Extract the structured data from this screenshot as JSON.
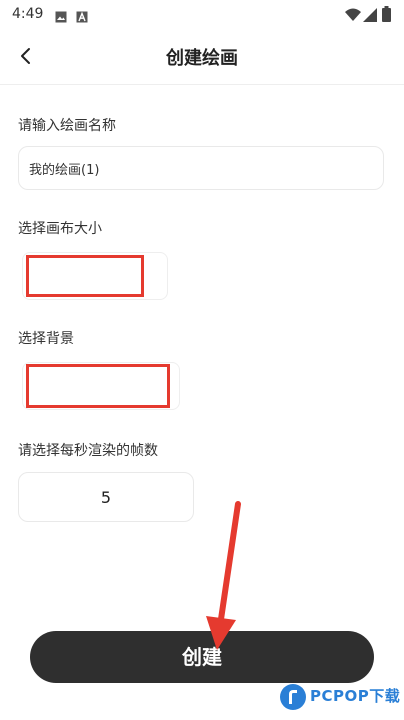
{
  "status_bar": {
    "time": "4:49",
    "icons": [
      "gallery-icon",
      "a-letter-icon",
      "wifi-icon",
      "signal-icon",
      "battery-icon"
    ]
  },
  "header": {
    "title": "创建绘画",
    "back_icon": "chevron-left-icon"
  },
  "form": {
    "name_label": "请输入绘画名称",
    "name_value": "我的绘画(1)",
    "size_label": "选择画布大小",
    "background_label": "选择背景",
    "fps_label": "请选择每秒渲染的帧数",
    "fps_value": "5"
  },
  "create_button": {
    "label": "创建"
  },
  "annotation": {
    "highlight_color": "#e53a2f",
    "arrow_color": "#e53a2f"
  },
  "watermark": {
    "text": "PCPOP下载"
  },
  "colors": {
    "button_bg": "#2f2f2f",
    "button_text": "#ffffff",
    "brand_blue": "#2a7fd6"
  }
}
